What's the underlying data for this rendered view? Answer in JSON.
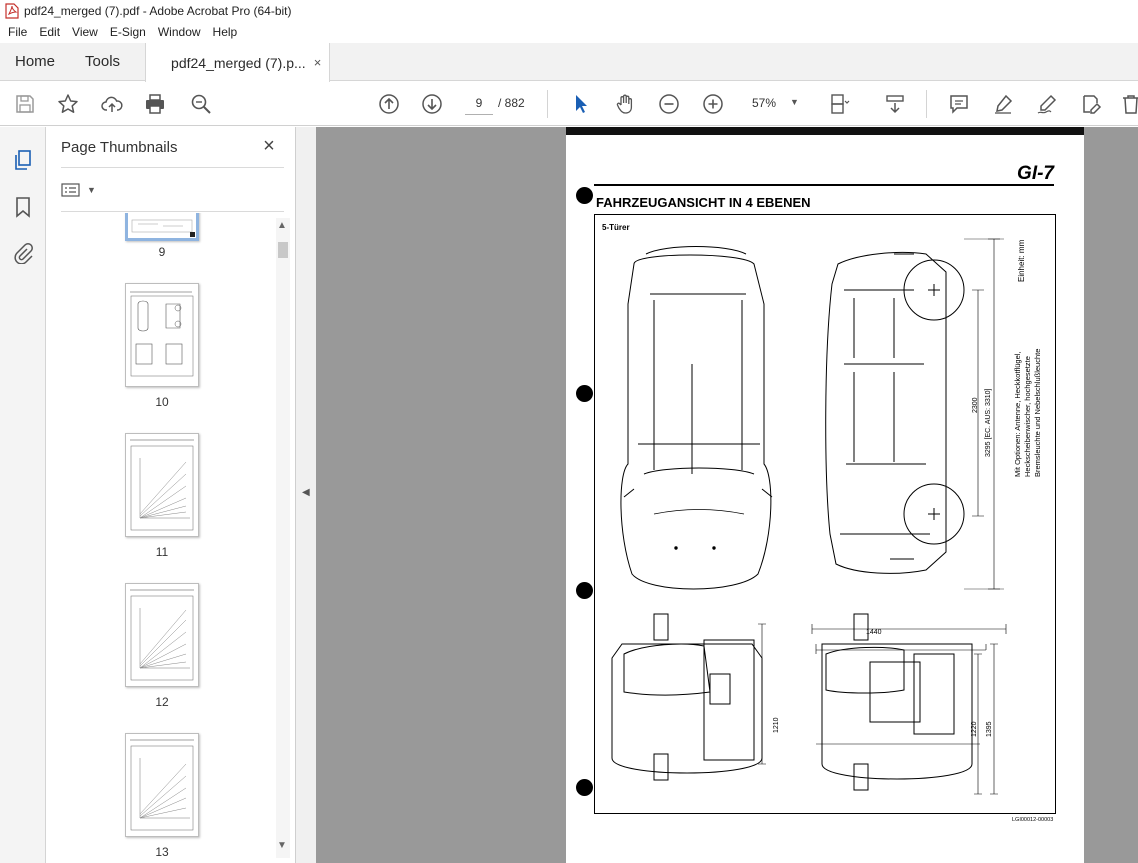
{
  "window": {
    "title": "pdf24_merged (7).pdf - Adobe Acrobat Pro (64-bit)"
  },
  "menu": [
    "File",
    "Edit",
    "View",
    "E-Sign",
    "Window",
    "Help"
  ],
  "tabs": {
    "home": "Home",
    "tools": "Tools",
    "document": "pdf24_merged (7).p...",
    "close_glyph": "×"
  },
  "toolbar": {
    "page_current": "9",
    "page_total": "/ 882",
    "zoom": "57%"
  },
  "thumbnails": {
    "title": "Page Thumbnails",
    "close_glyph": "×",
    "pages": [
      {
        "number": "9",
        "selected": true
      },
      {
        "number": "10",
        "selected": false
      },
      {
        "number": "11",
        "selected": false
      },
      {
        "number": "12",
        "selected": false
      },
      {
        "number": "13",
        "selected": false
      }
    ]
  },
  "document_page": {
    "section": "GI-7",
    "title": "FAHRZEUGANSICHT IN 4 EBENEN",
    "subtitle": "5-Türer",
    "unit_note": "Einheit: mm",
    "options_note": "Mit Optionen: Antenne, Heckkotflügel,\nHeckscheibenwischer, hochgesetzte\nBremsleuchte und Nebelschlußleuchte",
    "dimensions": {
      "wheelbase": "2300",
      "length": "3295 [EC. AUS: 3310]",
      "width": "1440",
      "track_front": "1210",
      "track_rear": "1220",
      "height": "1395"
    },
    "code": "LGI00012-00003"
  }
}
